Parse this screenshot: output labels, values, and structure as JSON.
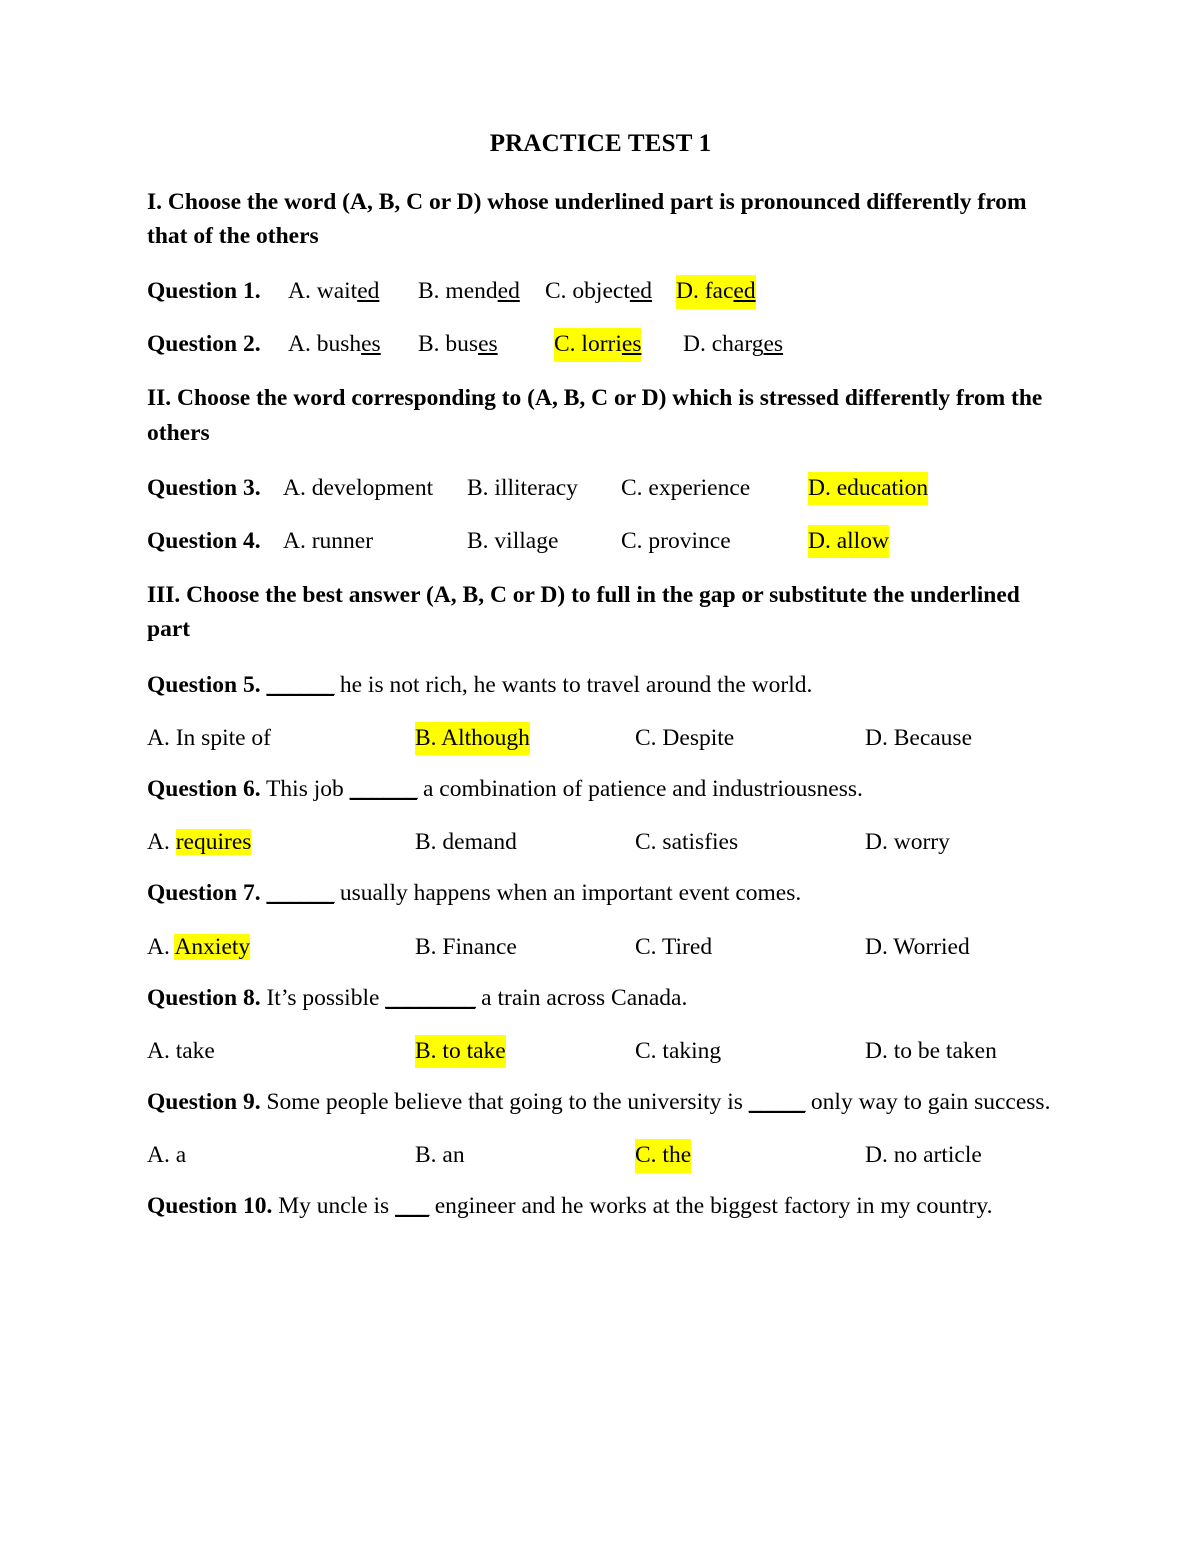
{
  "document": {
    "title": "PRACTICE TEST 1",
    "highlight_color": "#FFFF00",
    "background_color": "#FFFFFF",
    "text_color": "#000000"
  },
  "sections": {
    "s1": {
      "heading": "I. Choose the word (A, B, C or D) whose underlined part is pronounced differently from that of the others"
    },
    "s2": {
      "heading": "II. Choose the word corresponding to (A, B, C or D) which is stressed differently from the others"
    },
    "s3": {
      "heading": "III. Choose the best answer (A, B, C or D) to full in the gap or substitute the underlined part"
    }
  },
  "questions": {
    "q1": {
      "label": "Question 1.",
      "a_pre": "A. wait",
      "a_u": "ed",
      "b_pre": "B. mend",
      "b_u": "ed",
      "c_pre": "C. object",
      "c_u": "ed",
      "d_pre": "D. fac",
      "d_u": "ed",
      "highlighted": "D"
    },
    "q2": {
      "label": "Question 2.",
      "a_pre": "A. bush",
      "a_u": "es",
      "b_pre": "B. bus",
      "b_u": "es",
      "c_pre": "C. lorri",
      "c_u": "es",
      "d_pre": "D. charg",
      "d_u": "es",
      "highlighted": "C"
    },
    "q3": {
      "label": "Question 3.",
      "a": "A. development",
      "b": "B. illiteracy",
      "c": "C. experience",
      "d": "D. education",
      "highlighted": "D"
    },
    "q4": {
      "label": "Question 4.",
      "a": "A. runner",
      "b": "B. village",
      "c": "C. province",
      "d": "D. allow",
      "highlighted": "D"
    },
    "q5": {
      "label": "Question 5.",
      "blank": "______",
      "stem": " he is not rich, he wants to travel around the world.",
      "a": "A. In spite of",
      "b": "B. Although",
      "c": "C. Despite",
      "d": "D. Because",
      "highlighted": "B"
    },
    "q6": {
      "label": "Question 6.",
      "stem_pre": " This job ",
      "blank": "______",
      "stem_post": " a combination of patience and industriousness.",
      "a_prefix": "A. ",
      "a_word": "requires",
      "b": "B. demand",
      "c": "C. satisfies",
      "d": "D. worry",
      "highlighted": "A"
    },
    "q7": {
      "label": "Question 7.",
      "blank": "______",
      "stem": " usually happens when an important event comes.",
      "a_prefix": "A. ",
      "a_word": "Anxiety",
      "b": "B. Finance",
      "c": "C. Tired",
      "d": "D. Worried",
      "highlighted": "A"
    },
    "q8": {
      "label": "Question 8.",
      "stem_pre": " It’s possible ",
      "blank": "________",
      "stem_post": " a train across Canada.",
      "a": "A. take",
      "b": "B. to take",
      "c": "C. taking",
      "d": "D. to be taken",
      "highlighted": "B"
    },
    "q9": {
      "label": "Question 9.",
      "stem_pre": " Some people believe that going to the university is ",
      "blank": "_____",
      "stem_post": " only way to gain success.",
      "a": "A. a",
      "b": "B. an",
      "c": "C. the",
      "d": "D. no article",
      "highlighted": "C"
    },
    "q10": {
      "label": "Question 10.",
      "stem_pre": " My uncle is ",
      "blank": "___",
      "stem_post": " engineer and he works at the biggest factory in my country."
    }
  }
}
